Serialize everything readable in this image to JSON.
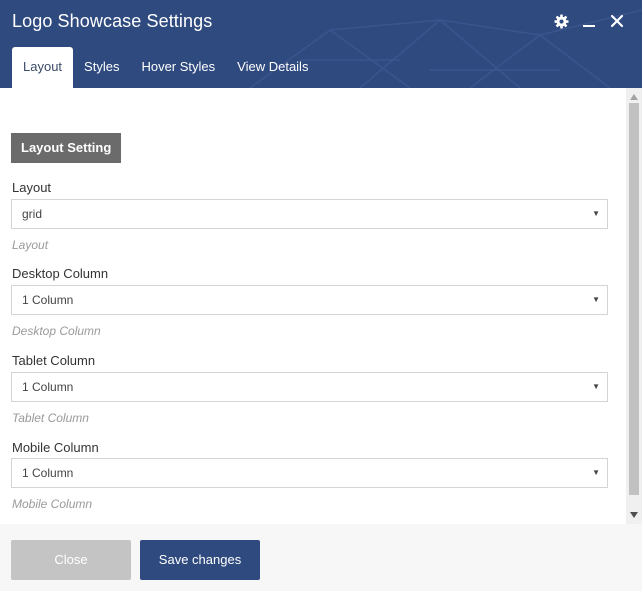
{
  "dialog": {
    "title": "Logo Showcase Settings"
  },
  "header_icons": [
    "gear-icon",
    "minimize-icon",
    "close-icon"
  ],
  "tabs": [
    {
      "label": "Layout",
      "active": true
    },
    {
      "label": "Styles",
      "active": false
    },
    {
      "label": "Hover Styles",
      "active": false
    },
    {
      "label": "View Details",
      "active": false
    }
  ],
  "section": {
    "title": "Layout Setting"
  },
  "fields": [
    {
      "label": "Layout",
      "value": "grid",
      "hint": "Layout"
    },
    {
      "label": "Desktop Column",
      "value": "1 Column",
      "hint": "Desktop Column"
    },
    {
      "label": "Tablet Column",
      "value": "1 Column",
      "hint": "Tablet Column"
    },
    {
      "label": "Mobile Column",
      "value": "1 Column",
      "hint": "Mobile Column"
    }
  ],
  "footer": {
    "close_label": "Close",
    "save_label": "Save changes"
  },
  "colors": {
    "header": "#2f4a7f",
    "badge": "#6b6b6b",
    "close_button": "#c4c4c4",
    "save_button": "#2f4a7f"
  }
}
